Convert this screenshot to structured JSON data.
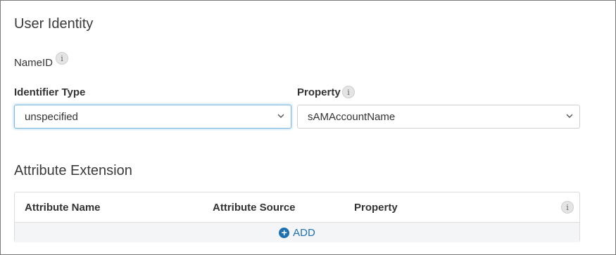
{
  "user_identity": {
    "title": "User Identity",
    "nameid_label": "NameID",
    "identifier_type": {
      "label": "Identifier Type",
      "value": "unspecified"
    },
    "property": {
      "label": "Property",
      "value": "sAMAccountName"
    }
  },
  "attribute_extension": {
    "title": "Attribute Extension",
    "columns": [
      "Attribute Name",
      "Attribute Source",
      "Property"
    ],
    "add_label": "ADD"
  },
  "icons": {
    "info": "info-icon",
    "chevron": "chevron-down-icon",
    "add": "plus-circle-icon"
  },
  "colors": {
    "accent": "#1f6fb3",
    "focus_border": "#7fb8e0"
  }
}
